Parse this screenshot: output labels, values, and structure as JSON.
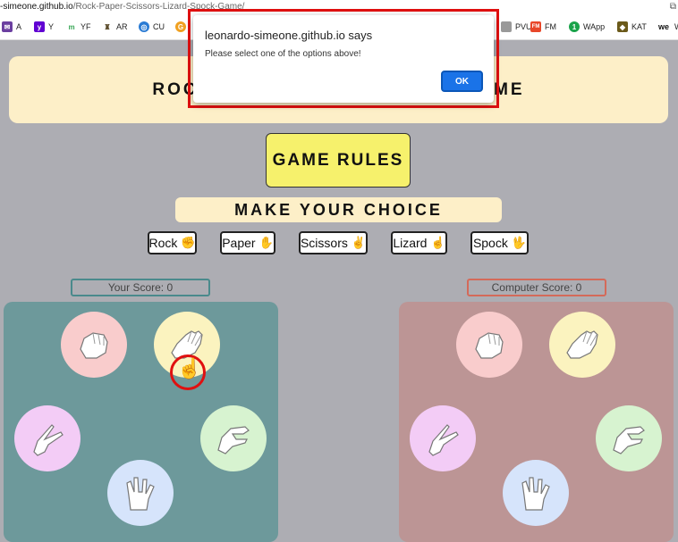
{
  "browser": {
    "url_host": "-simeone.github.io",
    "url_path": "/Rock-Paper-Scissors-Lizard-Spock-Game/",
    "bookmarks": [
      {
        "label": "A",
        "color": "#6b3fa0"
      },
      {
        "label": "Y",
        "color": "#6001d2"
      },
      {
        "label": "YF",
        "color": "#3aa757"
      },
      {
        "label": "AR",
        "color": "#5a4a2a"
      },
      {
        "label": "CU",
        "color": "#2a7bd4"
      },
      {
        "label": "PVU",
        "color": "#888888"
      },
      {
        "label": "FM",
        "color": "#e8472a"
      },
      {
        "label": "WApp",
        "color": "#1aa34a"
      },
      {
        "label": "KAT",
        "color": "#6b5a1a"
      },
      {
        "label": "W",
        "color": "#111111"
      }
    ]
  },
  "page": {
    "title_left": "ROCK PA",
    "title_right": "K GAME",
    "rules_label": "GAME RULES",
    "choice_label": "MAKE YOUR CHOICE",
    "options": [
      "Rock",
      "Paper",
      "Scissors",
      "Lizard",
      "Spock"
    ],
    "your_score": "Your Score: 0",
    "computer_score": "Computer Score: 0"
  },
  "dialog": {
    "title": "leonardo-simeone.github.io says",
    "message": "Please select one of the options above!",
    "ok_label": "OK"
  },
  "colors": {
    "background": "#adadb3",
    "banner": "#fdefc8",
    "rules_button": "#f6f16c",
    "player_board": "#6d999b",
    "computer_board": "#bc9595",
    "ok_button": "#1a73e8",
    "highlight": "#e01010"
  }
}
